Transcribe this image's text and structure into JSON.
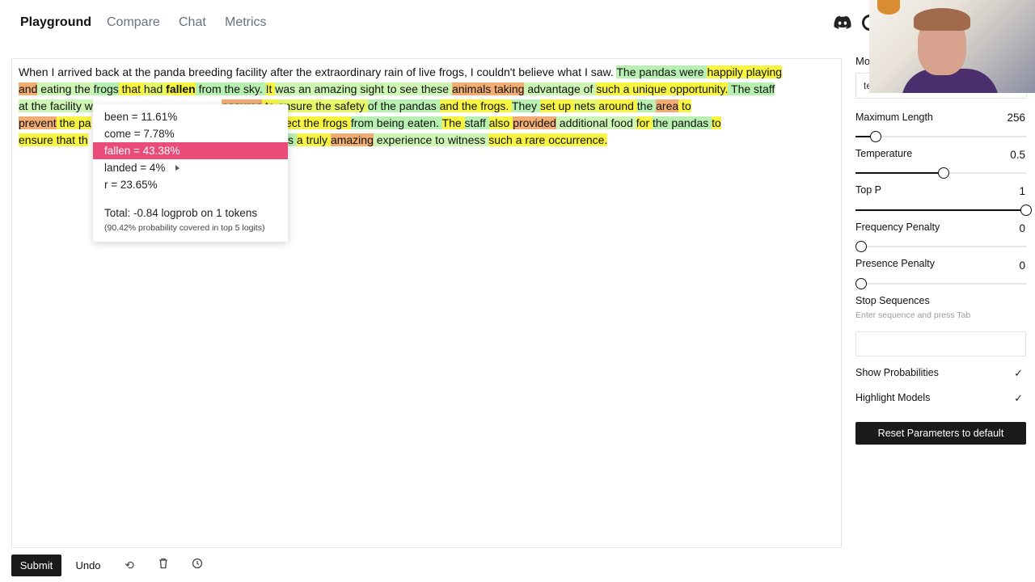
{
  "nav": {
    "tabs": [
      "Playground",
      "Compare",
      "Chat",
      "Metrics"
    ],
    "active": "Playground"
  },
  "editor": {
    "lines": [
      [
        {
          "t": "When I arrived back at the panda breeding facility after the extraordinary rain of live frogs, I couldn't believe what I saw. ",
          "c": ""
        },
        {
          "t": "The pandas were ",
          "c": "g"
        },
        {
          "t": "happily playing",
          "c": "y"
        }
      ],
      [
        {
          "t": "and",
          "c": "o"
        },
        {
          "t": " eating the ",
          "c": "lg"
        },
        {
          "t": "frogs",
          "c": "g"
        },
        {
          "t": " that ",
          "c": "y"
        },
        {
          "t": "had ",
          "c": "yg"
        },
        {
          "t": "fallen",
          "c": "y b"
        },
        {
          "t": " from the sky. ",
          "c": "g"
        },
        {
          "t": "It ",
          "c": "y"
        },
        {
          "t": "was an amazing sight to see these ",
          "c": "lg"
        },
        {
          "t": "animals taking",
          "c": "o"
        },
        {
          "t": " advantage of ",
          "c": "lg"
        },
        {
          "t": "such a unique opportunity.",
          "c": "y"
        },
        {
          "t": " The staff",
          "c": "g"
        }
      ],
      [
        {
          "t": "at the facility ",
          "c": "lg"
        },
        {
          "t": "w",
          "c": "lg"
        },
        {
          "t": "                                         ",
          "c": ""
        },
        {
          "t": "easures",
          "c": "o"
        },
        {
          "t": " to ",
          "c": "y"
        },
        {
          "t": "ensure the safety ",
          "c": "yg"
        },
        {
          "t": "of the pandas ",
          "c": "g"
        },
        {
          "t": "and the frogs. ",
          "c": "y"
        },
        {
          "t": "They ",
          "c": "g"
        },
        {
          "t": "set up ",
          "c": "y"
        },
        {
          "t": "nets ",
          "c": "yg"
        },
        {
          "t": "around ",
          "c": "y"
        },
        {
          "t": "the ",
          "c": "g"
        },
        {
          "t": "area",
          "c": "o"
        },
        {
          "t": " to",
          "c": "y"
        }
      ],
      [
        {
          "t": "prevent",
          "c": "o"
        },
        {
          "t": " the pa",
          "c": "y"
        },
        {
          "t": "                                         ",
          "c": ""
        },
        {
          "t": "d also to ",
          "c": "yg"
        },
        {
          "t": "protect the frogs ",
          "c": "y"
        },
        {
          "t": "from being eaten. ",
          "c": "g"
        },
        {
          "t": "The ",
          "c": "y"
        },
        {
          "t": "staff ",
          "c": "g"
        },
        {
          "t": "also ",
          "c": "y"
        },
        {
          "t": "provided",
          "c": "o"
        },
        {
          "t": " additional food ",
          "c": "lg"
        },
        {
          "t": "for ",
          "c": "y"
        },
        {
          "t": "the pandas ",
          "c": "g"
        },
        {
          "t": "to",
          "c": "y"
        }
      ],
      [
        {
          "t": "ensure that th",
          "c": "y"
        },
        {
          "t": "                                                        ",
          "c": ""
        },
        {
          "t": "It was ",
          "c": "g"
        },
        {
          "t": "a truly ",
          "c": "y"
        },
        {
          "t": "amazing",
          "c": "o"
        },
        {
          "t": " experience to witness ",
          "c": "lg"
        },
        {
          "t": "such a rare occurrence.",
          "c": "y"
        }
      ]
    ]
  },
  "popup": {
    "options": [
      {
        "label": "been = 11.61%",
        "selected": false
      },
      {
        "label": "come = 7.78%",
        "selected": false
      },
      {
        "label": "fallen = 43.38%",
        "selected": true
      },
      {
        "label": "landed = 4%",
        "selected": false
      },
      {
        "label": "r = 23.65%",
        "selected": false
      }
    ],
    "total": "Total: -0.84 logprob on 1 tokens",
    "coverage": "(90.42% probability covered in top 5 logits)"
  },
  "panel": {
    "model_label": "Mo",
    "model_value": "te",
    "params": [
      {
        "label": "Maximum Length",
        "value": "256",
        "fraction": 0.09
      },
      {
        "label": "Temperature",
        "value": "0.5",
        "fraction": 0.5
      },
      {
        "label": "Top P",
        "value": "1",
        "fraction": 1.0
      },
      {
        "label": "Frequency Penalty",
        "value": "0",
        "fraction": 0.0
      },
      {
        "label": "Presence Penalty",
        "value": "0",
        "fraction": 0.0
      }
    ],
    "stop_label": "Stop Sequences",
    "stop_placeholder": "Enter sequence and press Tab",
    "show_probabilities": "Show Probabilities",
    "highlight_models": "Highlight Models",
    "reset_label": "Reset Parameters to default"
  },
  "toolbar": {
    "submit_label": "Submit",
    "undo_label": "Undo",
    "icons": [
      "regenerate-icon",
      "trash-icon",
      "history-icon"
    ]
  }
}
